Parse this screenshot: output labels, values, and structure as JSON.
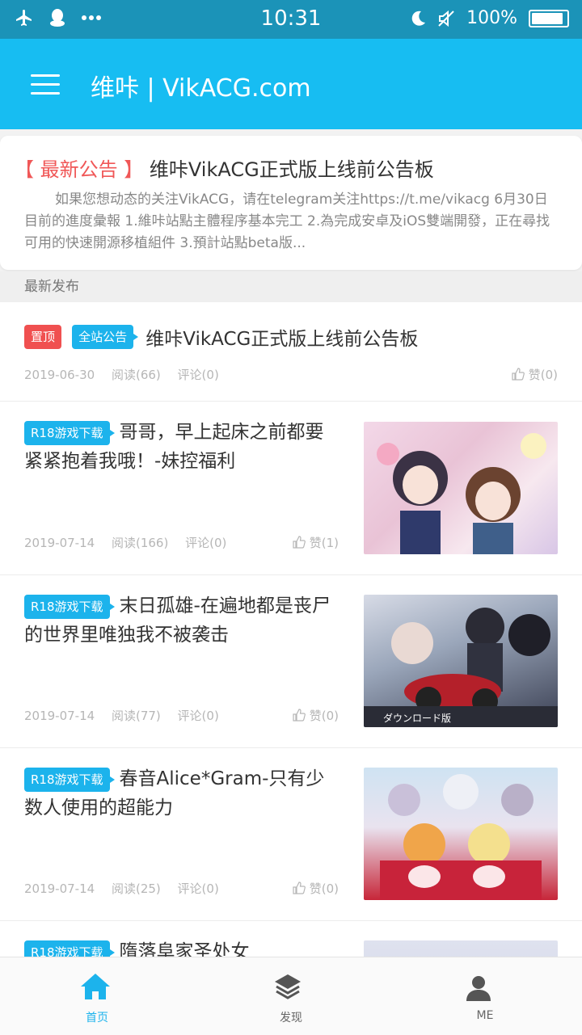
{
  "status_bar": {
    "time": "10:31",
    "battery": "100%",
    "battery_level": 1.0,
    "icons": [
      "airplane-icon",
      "qq-icon",
      "more-dots-icon",
      "moon-icon",
      "mute-icon",
      "battery-icon"
    ]
  },
  "app_bar": {
    "title": "维咔 | VikACG.com",
    "menu_icon": "hamburger-menu-icon",
    "color": "#17bdf2"
  },
  "notice": {
    "tag": "【 最新公告 】",
    "title": "维咔VikACG正式版上线前公告板",
    "body": "如果您想动态的关注VikACG，请在telegram关注https://t.me/vikacg 6月30日 目前的進度彙報 1.維咔站點主體程序基本完工 2.為完成安卓及iOS雙端開發，正在尋找可用的快速開源移植組件 3.預計站點beta版..."
  },
  "section": {
    "label": "最新发布"
  },
  "pinned": {
    "badge_top": "置顶",
    "badge_category": "全站公告",
    "title": "维咔VikACG正式版上线前公告板",
    "date": "2019-06-30",
    "reads": "阅读(66)",
    "comments": "评论(0)",
    "likes": "赞(0)"
  },
  "articles": [
    {
      "category": "R18游戏下载",
      "title": "哥哥，早上起床之前都要紧紧抱着我哦！-妹控福利",
      "date": "2019-07-14",
      "reads": "阅读(166)",
      "comments": "评论(0)",
      "likes": "赞(1)"
    },
    {
      "category": "R18游戏下载",
      "title": "末日孤雄-在遍地都是丧尸的世界里唯独我不被袭击",
      "date": "2019-07-14",
      "reads": "阅读(77)",
      "comments": "评论(0)",
      "likes": "赞(0)",
      "thumb_caption": "ダウンロード版"
    },
    {
      "category": "R18游戏下载",
      "title": "春音Alice*Gram-只有少数人使用的超能力",
      "date": "2019-07-14",
      "reads": "阅读(25)",
      "comments": "评论(0)",
      "likes": "赞(0)"
    },
    {
      "category": "R18游戏下载",
      "title": "隋落阜家圣处女"
    }
  ],
  "tab_bar": {
    "tabs": [
      {
        "label": "首页",
        "icon": "home-icon",
        "active": true
      },
      {
        "label": "发现",
        "icon": "layers-icon",
        "active": false
      },
      {
        "label": "ME",
        "icon": "user-icon",
        "active": false
      }
    ]
  },
  "colors": {
    "accent": "#1cb3ec",
    "notice_tag": "#f05757",
    "pinned_badge": "#f05050",
    "status_bar": "#1b93b8"
  }
}
